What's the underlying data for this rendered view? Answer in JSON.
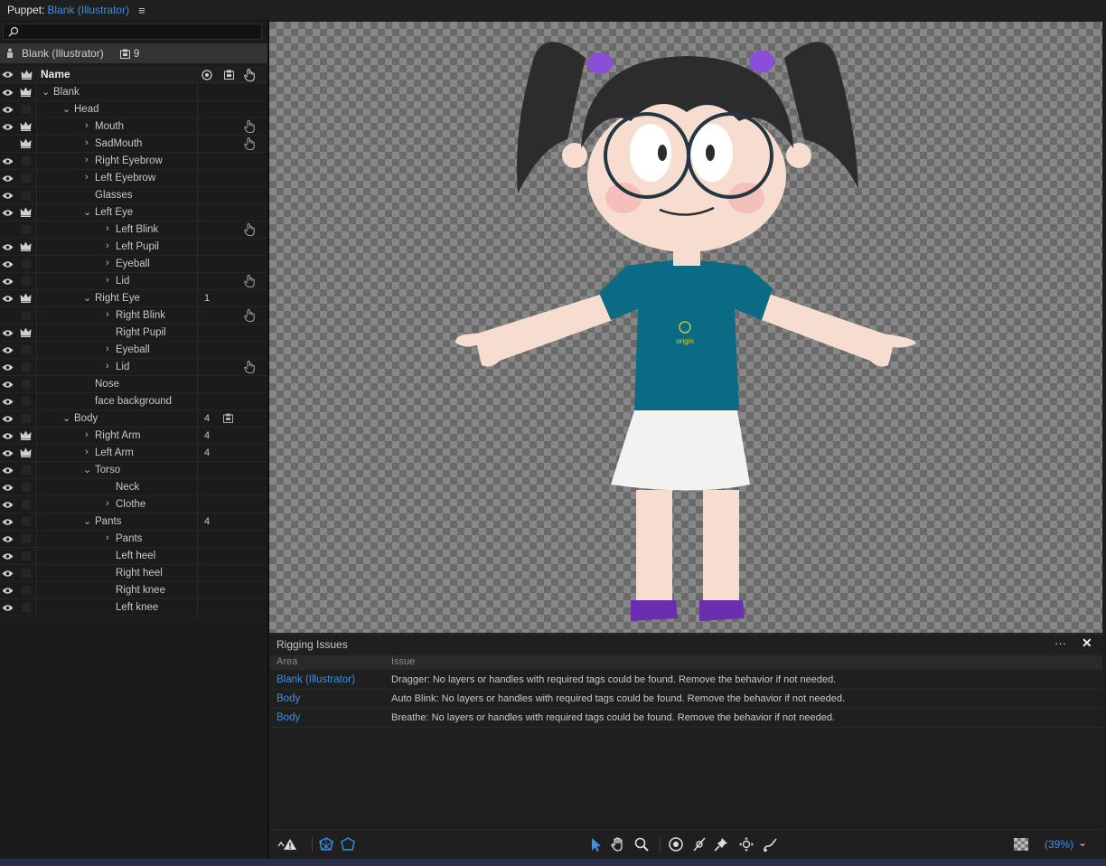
{
  "titlebar": {
    "panel": "Puppet:",
    "puppet_name": "Blank (Illustrator)",
    "menu_icon": "hamburger-icon"
  },
  "search": {
    "placeholder": ""
  },
  "puppet_header": {
    "name": "Blank (Illustrator)",
    "count": "9"
  },
  "columns": {
    "name": "Name"
  },
  "layers": [
    {
      "label": "Blank",
      "depth": 0,
      "chevron": "down",
      "eye": true,
      "crown": true,
      "num": "",
      "tag": false,
      "hand": false
    },
    {
      "label": "Head",
      "depth": 1,
      "chevron": "down",
      "eye": true,
      "crown": false,
      "num": "",
      "tag": false,
      "hand": false
    },
    {
      "label": "Mouth",
      "depth": 2,
      "chevron": "right",
      "eye": true,
      "crown": true,
      "num": "",
      "tag": false,
      "hand": true
    },
    {
      "label": "SadMouth",
      "depth": 2,
      "chevron": "right",
      "eye": false,
      "crown": true,
      "num": "",
      "tag": false,
      "hand": true
    },
    {
      "label": "Right Eyebrow",
      "depth": 2,
      "chevron": "right",
      "eye": true,
      "crown": false,
      "num": "",
      "tag": false,
      "hand": false
    },
    {
      "label": "Left Eyebrow",
      "depth": 2,
      "chevron": "right",
      "eye": true,
      "crown": false,
      "num": "",
      "tag": false,
      "hand": false
    },
    {
      "label": "Glasses",
      "depth": 2,
      "chevron": "",
      "eye": true,
      "crown": false,
      "num": "",
      "tag": false,
      "hand": false
    },
    {
      "label": "Left Eye",
      "depth": 2,
      "chevron": "down",
      "eye": true,
      "crown": true,
      "num": "",
      "tag": false,
      "hand": false
    },
    {
      "label": "Left Blink",
      "depth": 3,
      "chevron": "right",
      "eye": false,
      "crown": false,
      "num": "",
      "tag": false,
      "hand": true
    },
    {
      "label": "Left Pupil",
      "depth": 3,
      "chevron": "right",
      "eye": true,
      "crown": true,
      "num": "",
      "tag": false,
      "hand": false
    },
    {
      "label": "Eyeball",
      "depth": 3,
      "chevron": "right",
      "eye": true,
      "crown": false,
      "num": "",
      "tag": false,
      "hand": false
    },
    {
      "label": "Lid",
      "depth": 3,
      "chevron": "right",
      "eye": true,
      "crown": false,
      "num": "",
      "tag": false,
      "hand": true
    },
    {
      "label": "Right Eye",
      "depth": 2,
      "chevron": "down",
      "eye": true,
      "crown": true,
      "num": "1",
      "tag": false,
      "hand": false
    },
    {
      "label": "Right Blink",
      "depth": 3,
      "chevron": "right",
      "eye": false,
      "crown": false,
      "num": "",
      "tag": false,
      "hand": true
    },
    {
      "label": "Right Pupil",
      "depth": 3,
      "chevron": "",
      "eye": true,
      "crown": true,
      "num": "",
      "tag": false,
      "hand": false
    },
    {
      "label": "Eyeball",
      "depth": 3,
      "chevron": "right",
      "eye": true,
      "crown": false,
      "num": "",
      "tag": false,
      "hand": false
    },
    {
      "label": "Lid",
      "depth": 3,
      "chevron": "right",
      "eye": true,
      "crown": false,
      "num": "",
      "tag": false,
      "hand": true
    },
    {
      "label": "Nose",
      "depth": 2,
      "chevron": "",
      "eye": true,
      "crown": false,
      "num": "",
      "tag": false,
      "hand": false
    },
    {
      "label": "face background",
      "depth": 2,
      "chevron": "",
      "eye": true,
      "crown": false,
      "num": "",
      "tag": false,
      "hand": false
    },
    {
      "label": "Body",
      "depth": 1,
      "chevron": "down",
      "eye": true,
      "crown": false,
      "num": "4",
      "tag": true,
      "hand": false
    },
    {
      "label": "Right Arm",
      "depth": 2,
      "chevron": "right",
      "eye": true,
      "crown": true,
      "num": "4",
      "tag": false,
      "hand": false
    },
    {
      "label": "Left Arm",
      "depth": 2,
      "chevron": "right",
      "eye": true,
      "crown": true,
      "num": "4",
      "tag": false,
      "hand": false
    },
    {
      "label": "Torso",
      "depth": 2,
      "chevron": "down",
      "eye": true,
      "crown": false,
      "num": "",
      "tag": false,
      "hand": false
    },
    {
      "label": "Neck",
      "depth": 3,
      "chevron": "",
      "eye": true,
      "crown": false,
      "num": "",
      "tag": false,
      "hand": false
    },
    {
      "label": "Clothe",
      "depth": 3,
      "chevron": "right",
      "eye": true,
      "crown": false,
      "num": "",
      "tag": false,
      "hand": false
    },
    {
      "label": "Pants",
      "depth": 2,
      "chevron": "down",
      "eye": true,
      "crown": false,
      "num": "4",
      "tag": false,
      "hand": false
    },
    {
      "label": "Pants",
      "depth": 3,
      "chevron": "right",
      "eye": true,
      "crown": false,
      "num": "",
      "tag": false,
      "hand": false
    },
    {
      "label": "Left heel",
      "depth": 3,
      "chevron": "",
      "eye": true,
      "crown": false,
      "num": "",
      "tag": false,
      "hand": false
    },
    {
      "label": "Right heel",
      "depth": 3,
      "chevron": "",
      "eye": true,
      "crown": false,
      "num": "",
      "tag": false,
      "hand": false
    },
    {
      "label": "Right knee",
      "depth": 3,
      "chevron": "",
      "eye": true,
      "crown": false,
      "num": "",
      "tag": false,
      "hand": false
    },
    {
      "label": "Left knee",
      "depth": 3,
      "chevron": "",
      "eye": true,
      "crown": false,
      "num": "",
      "tag": false,
      "hand": false
    }
  ],
  "canvas": {
    "origin_label": "origin"
  },
  "rigging_issues": {
    "title": "Rigging Issues",
    "col_area": "Area",
    "col_issue": "Issue",
    "rows": [
      {
        "area": "Blank (Illustrator)",
        "issue": "Dragger: No layers or handles with required tags could be found. Remove the behavior if not needed."
      },
      {
        "area": "Body",
        "issue": "Auto Blink: No layers or handles with required tags could be found. Remove the behavior if not needed."
      },
      {
        "area": "Body",
        "issue": "Breathe: No layers or handles with required tags could be found. Remove the behavior if not needed."
      }
    ]
  },
  "toolbar": {
    "zoom": "(39%)",
    "tools": [
      "select-tool-icon",
      "hand-tool-icon",
      "zoom-tool-icon",
      "origin-tool-icon",
      "stick-tool-icon",
      "pin-tool-icon",
      "dragger-tool-icon",
      "draw-tool-icon"
    ]
  },
  "colors": {
    "accent": "#3b8fe8",
    "panel": "#1b1b1b",
    "header": "#333333"
  }
}
